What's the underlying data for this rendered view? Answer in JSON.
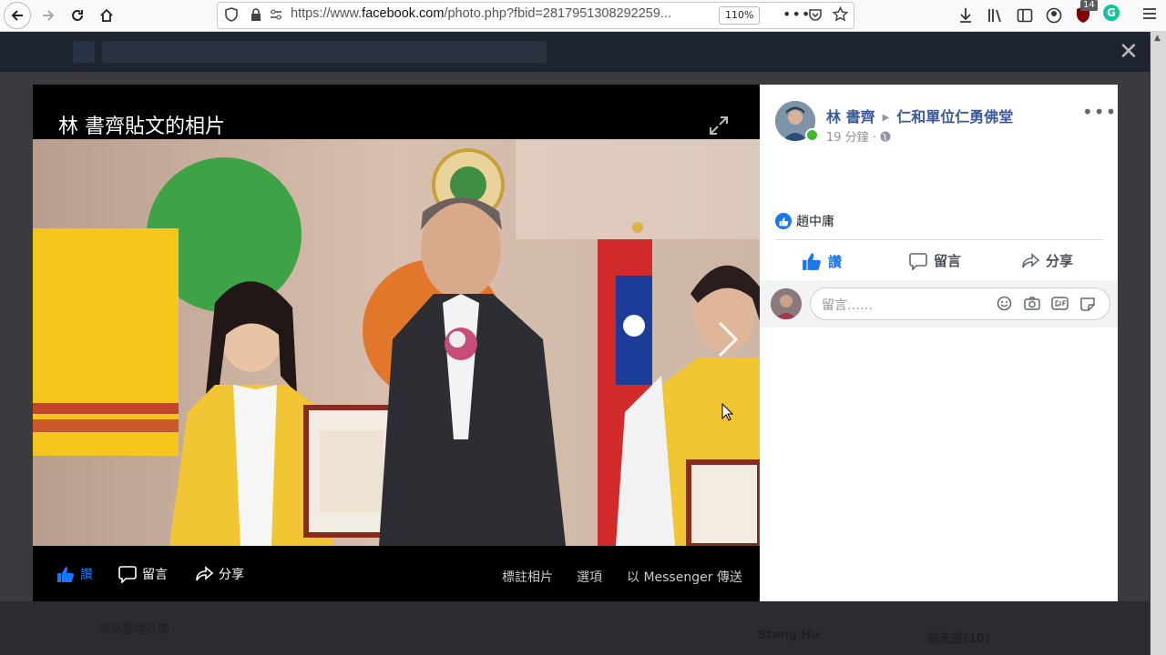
{
  "browser": {
    "url_prefix": "https://www.",
    "url_host": "facebook.com",
    "url_path": "/photo.php?fbid=2817951308292259...",
    "zoom": "110%",
    "extension_badge": "14"
  },
  "photo": {
    "title": "林 書齊貼文的相片",
    "actions": {
      "like": "讚",
      "comment": "留言",
      "share": "分享",
      "tag": "標註相片",
      "options": "選項",
      "messenger": "以 Messenger 傳送"
    }
  },
  "post": {
    "author": "林 書齊",
    "target": "仁和單位仁勇佛堂",
    "time": "19 分鐘",
    "reactor": "趙中庸",
    "buttons": {
      "like": "讚",
      "comment": "留言",
      "share": "分享"
    },
    "comment_placeholder": "留言……"
  },
  "background": {
    "sidebar_label": "商品管理社團",
    "chat_name": "Stang Hu",
    "chat_label": "聊天室(10)"
  },
  "colors": {
    "fb_blue": "#1877f2",
    "link_blue": "#385898",
    "online_green": "#42b72a"
  }
}
